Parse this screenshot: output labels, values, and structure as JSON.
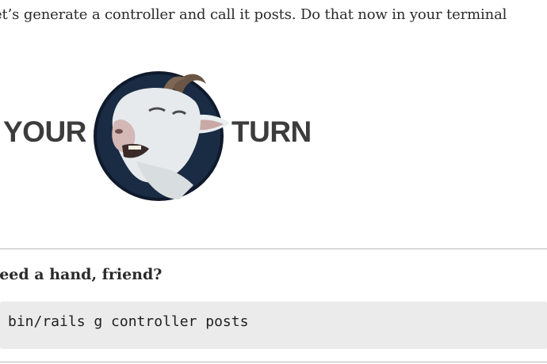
{
  "intro_text": "et’s generate a controller and call it posts.  Do that now in your terminal",
  "badge": {
    "left_word": "YOUR",
    "right_word": "TURN",
    "mascot": "goat-mascot-icon"
  },
  "hint": {
    "title": "leed a hand, friend?"
  },
  "code": {
    "command": "bin/rails g controller posts"
  },
  "colors": {
    "code_bg": "#ebebeb",
    "divider": "#b9b9b9",
    "badge_circle": "#1a2b44"
  }
}
